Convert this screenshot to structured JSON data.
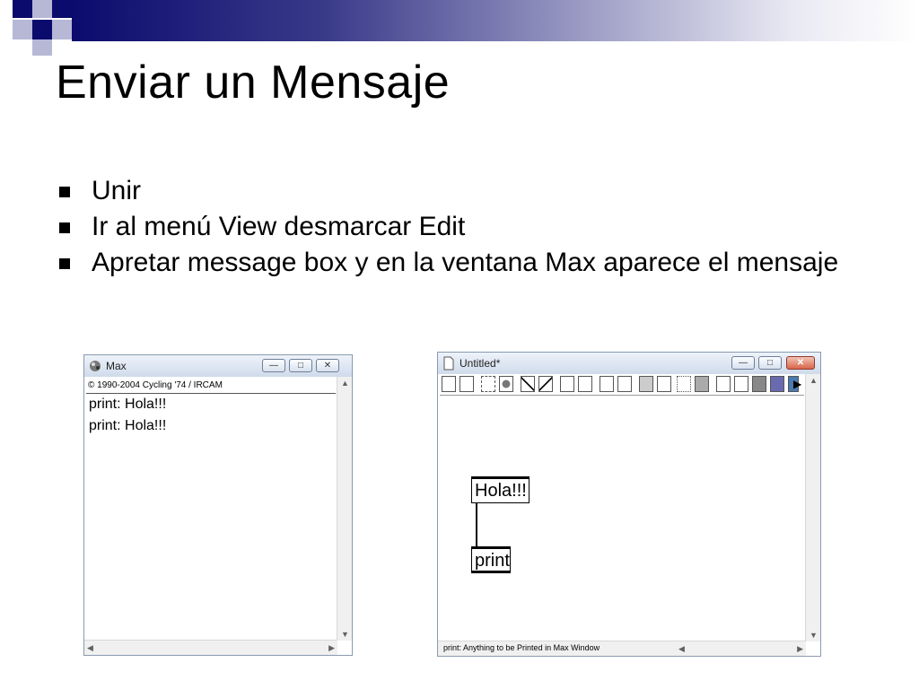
{
  "slide": {
    "title": "Enviar un Mensaje",
    "bullets": [
      "Unir",
      "Ir al menú View desmarcar Edit",
      "Apretar message box y en la ventana Max aparece el mensaje"
    ]
  },
  "max_window": {
    "title": "Max",
    "copyright": "© 1990-2004 Cycling '74 / IRCAM",
    "log_lines": [
      "print: Hola!!!",
      "print: Hola!!!"
    ]
  },
  "patch_window": {
    "title": "Untitled*",
    "message_box": "Hola!!!",
    "object_box": "print",
    "status": "print: Anything to be Printed in Max Window"
  },
  "window_controls": {
    "minimize": "—",
    "maximize": "□",
    "close": "✕"
  },
  "colors": {
    "accent": "#0b0b6e",
    "accent_light": "#b7b7d6",
    "window_border": "#8a9ab0"
  }
}
